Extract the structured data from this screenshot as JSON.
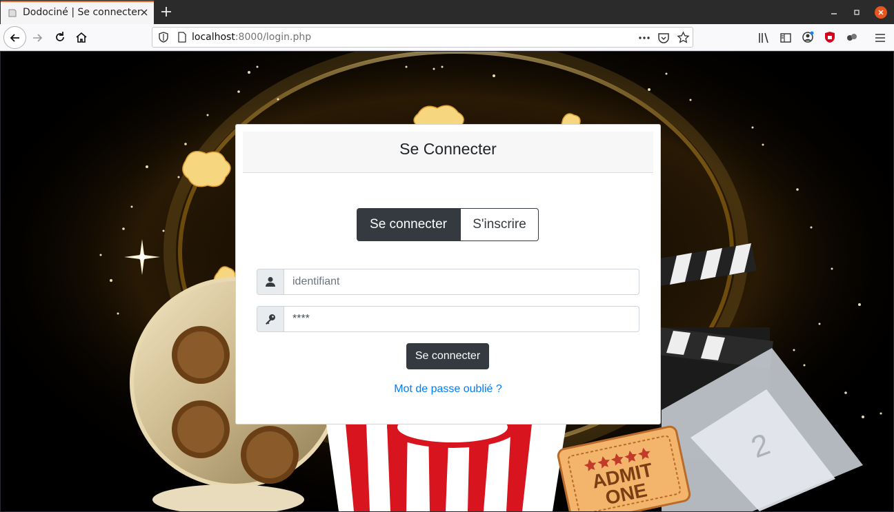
{
  "browser": {
    "tab_title": "Dodociné | Se connecter",
    "url_host": "localhost",
    "url_rest": ":8000/login.php",
    "accent": "#e8652c"
  },
  "card": {
    "title": "Se Connecter",
    "tabs": [
      {
        "label": "Se connecter",
        "active": true
      },
      {
        "label": "S'inscrire",
        "active": false
      }
    ],
    "username": {
      "placeholder": "identifiant",
      "icon": "user-icon"
    },
    "password": {
      "value": "****",
      "icon": "key-icon"
    },
    "submit_label": "Se connecter",
    "forgot_label": "Mot de passe oublié ?",
    "link_color": "#007bff",
    "dark_color": "#343a40"
  },
  "background": {
    "ticket_text_line1": "ADMIT",
    "ticket_text_line2": "ONE"
  }
}
